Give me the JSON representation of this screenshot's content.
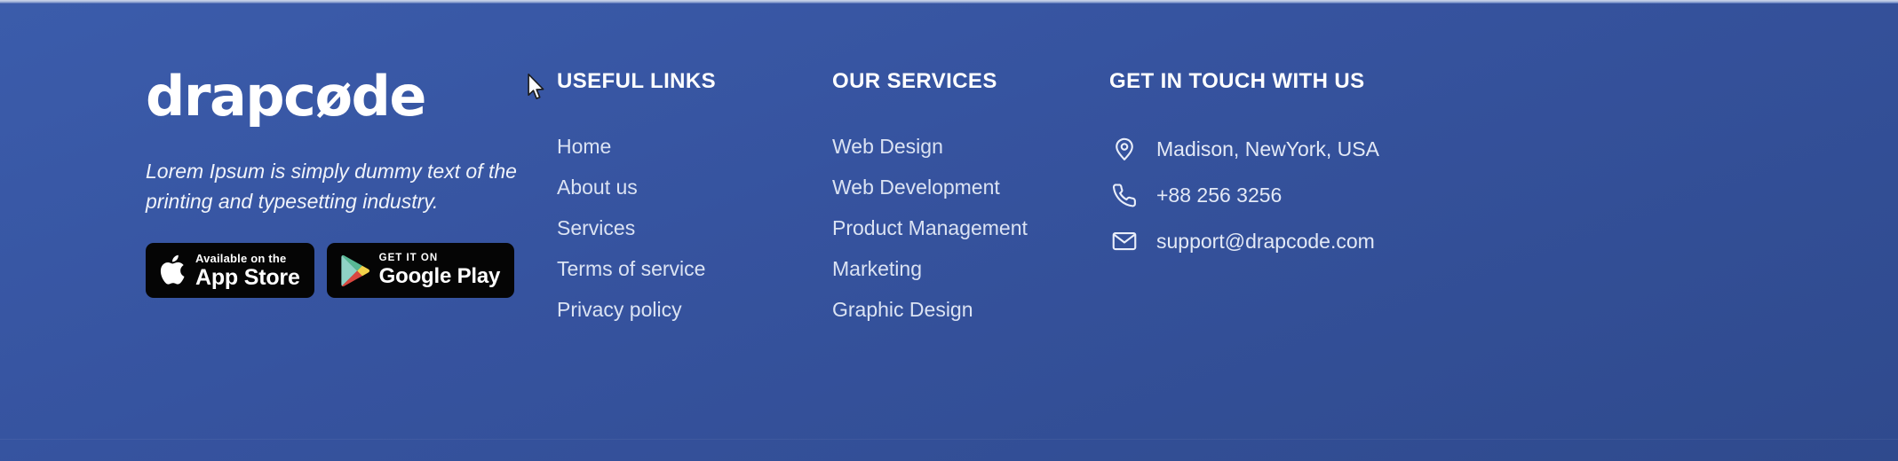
{
  "footer": {
    "background_color": "#36539f",
    "brand": {
      "logo_text_before": "drapc",
      "logo_text_slashed_o": "ø",
      "logo_text_after": "de",
      "logo_full": "drapcøde",
      "tagline": "Lorem Ipsum is simply dummy text of the printing and typesetting industry.",
      "badges": [
        {
          "icon": "apple-logo-icon",
          "small_label": "Available on the",
          "big_label": "App Store"
        },
        {
          "icon": "google-play-icon",
          "small_label": "GET IT ON",
          "big_label": "Google Play"
        }
      ]
    },
    "columns": [
      {
        "title": "USEFUL LINKS",
        "items": [
          "Home",
          "About us",
          "Services",
          "Terms of service",
          "Privacy policy"
        ]
      },
      {
        "title": "OUR SERVICES",
        "items": [
          "Web Design",
          "Web Development",
          "Product Management",
          "Marketing",
          "Graphic Design"
        ]
      }
    ],
    "contact": {
      "title": "GET IN TOUCH WITH US",
      "items": [
        {
          "icon": "location-pin-icon",
          "value": "Madison, NewYork, USA"
        },
        {
          "icon": "phone-icon",
          "value": "+88 256 3256"
        },
        {
          "icon": "envelope-icon",
          "value": "support@drapcode.com"
        }
      ]
    },
    "cursor": {
      "icon": "mouse-pointer-icon"
    }
  }
}
